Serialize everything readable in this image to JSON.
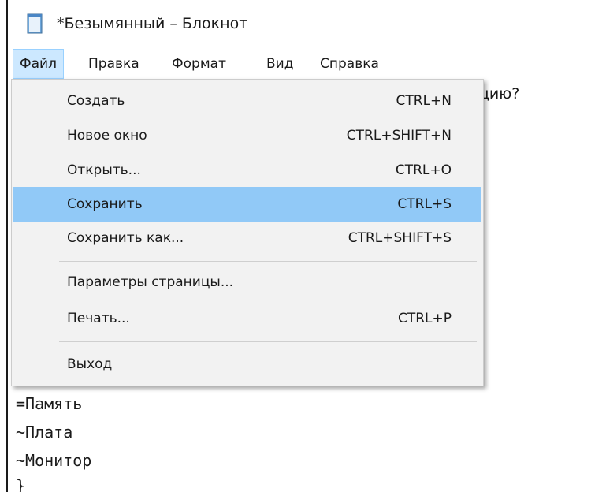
{
  "window": {
    "title": "*Безымянный – Блокнот",
    "icon": "notepad-icon"
  },
  "menubar": {
    "items": [
      {
        "label": "Файл",
        "active": true
      },
      {
        "label": "Правка"
      },
      {
        "label": "Формат"
      },
      {
        "label": "Вид"
      },
      {
        "label": "Справка"
      }
    ]
  },
  "file_menu": {
    "items": [
      {
        "label": "Создать",
        "shortcut": "CTRL+N"
      },
      {
        "label": "Новое окно",
        "shortcut": "CTRL+SHIFT+N"
      },
      {
        "label": "Открыть...",
        "shortcut": "CTRL+O"
      },
      {
        "label": "Сохранить",
        "shortcut": "CTRL+S",
        "highlighted": true
      },
      {
        "label": "Сохранить как...",
        "shortcut": "CTRL+SHIFT+S"
      },
      {
        "label": "Параметры страницы...",
        "shortcut": ""
      },
      {
        "label": "Печать...",
        "shortcut": "CTRL+P"
      },
      {
        "label": "Выход",
        "shortcut": ""
      }
    ],
    "highlight_color": "#91c9f7"
  },
  "editor": {
    "visible_fragment": "цию?",
    "lines": [
      "=Память",
      "~Плата",
      "~Монитор",
      "}"
    ]
  }
}
